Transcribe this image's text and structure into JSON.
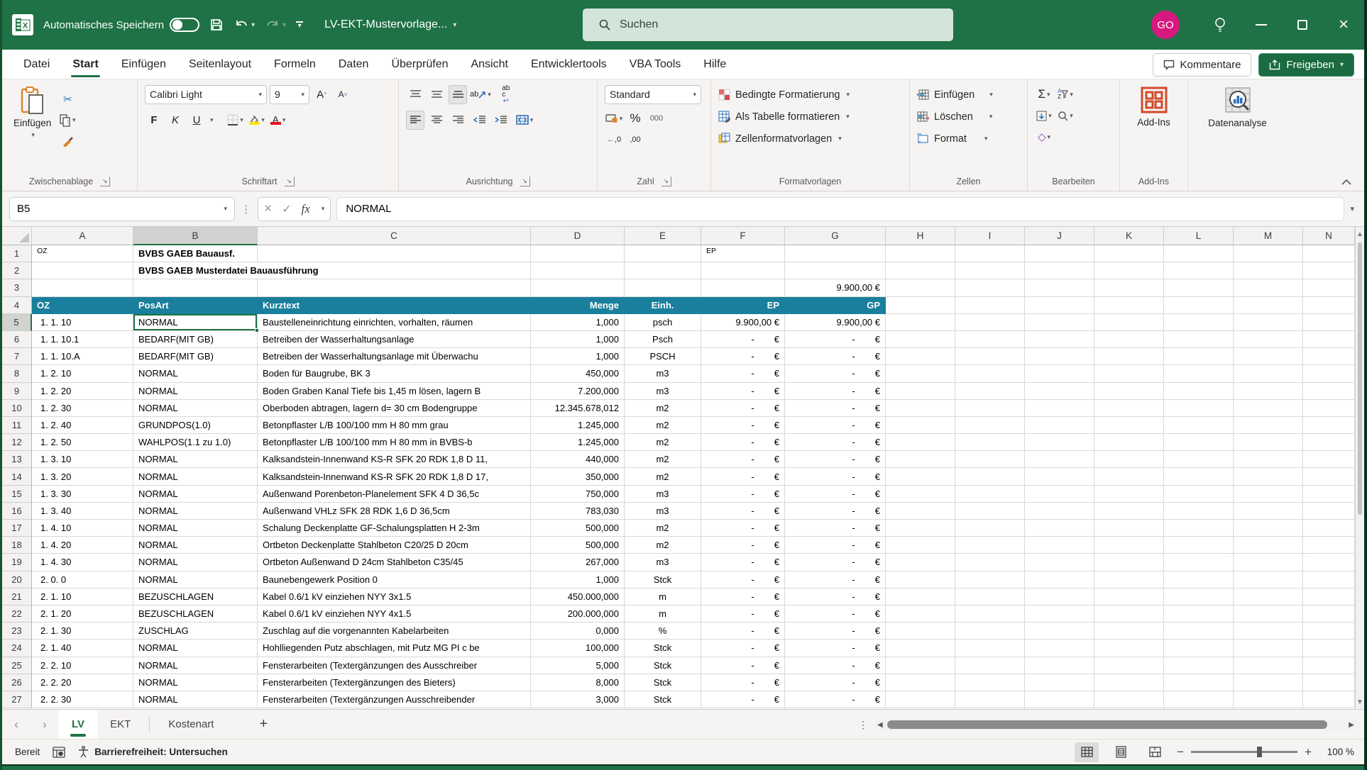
{
  "colors": {
    "titlebar_green": "#1f7245",
    "table_header_teal": "#1a7f9c",
    "selection_green": "#1f7245",
    "avatar_pink": "#d6187f",
    "share_button_green": "#1a6b3f"
  },
  "titlebar": {
    "autosave_label": "Automatisches Speichern",
    "autosave_state": "off",
    "document_title": "LV-EKT-Mustervorlage...",
    "search_placeholder": "Suchen",
    "avatar_initials": "GO"
  },
  "menubar": {
    "tabs": [
      "Datei",
      "Start",
      "Einfügen",
      "Seitenlayout",
      "Formeln",
      "Daten",
      "Überprüfen",
      "Ansicht",
      "Entwicklertools",
      "VBA Tools",
      "Hilfe"
    ],
    "active_tab": "Start",
    "comments_label": "Kommentare",
    "share_label": "Freigeben"
  },
  "ribbon": {
    "clipboard": {
      "label": "Zwischenablage",
      "paste_label": "Einfügen"
    },
    "font": {
      "label": "Schriftart",
      "name": "Calibri Light",
      "size": "9",
      "bold": "F",
      "italic": "K",
      "underline": "U"
    },
    "alignment": {
      "label": "Ausrichtung"
    },
    "number": {
      "label": "Zahl",
      "format": "Standard",
      "percent": "%",
      "thousands": "000",
      "dec_left": ",0",
      "dec_right": ",00"
    },
    "styles": {
      "label": "Formatvorlagen",
      "items": [
        "Bedingte Formatierung",
        "Als Tabelle formatieren",
        "Zellenformatvorlagen"
      ]
    },
    "cells": {
      "label": "Zellen",
      "items": [
        "Einfügen",
        "Löschen",
        "Format"
      ]
    },
    "editing": {
      "label": "Bearbeiten",
      "sigma": "Σ",
      "sort": "AZ"
    },
    "addins": {
      "button_label": "Add-Ins",
      "label": "Add-Ins"
    },
    "analysis": {
      "label": "Datenanalyse"
    }
  },
  "formula_bar": {
    "name_box": "B5",
    "formula": "NORMAL",
    "fx": "fx",
    "check": "✓",
    "cancel": "×"
  },
  "grid": {
    "columns": [
      "A",
      "B",
      "C",
      "D",
      "E",
      "F",
      "G",
      "H",
      "I",
      "J",
      "K",
      "L",
      "M",
      "N"
    ],
    "selected_cell": "B5",
    "selected_column": "B",
    "selected_row": 5,
    "currency_symbol": "€",
    "pre_rows": [
      {
        "num": 1,
        "cells": {
          "A": "OZ",
          "B": "BVBS GAEB Bauausf.",
          "F": "EP"
        }
      },
      {
        "num": 2,
        "cells": {
          "B": "BVBS GAEB Musterdatei Bauausführung"
        }
      },
      {
        "num": 3,
        "cells": {
          "G": "9.900,00 €"
        }
      }
    ],
    "header_row": {
      "num": 4,
      "oz": "OZ",
      "posart": "PosArt",
      "kurztext": "Kurztext",
      "menge": "Menge",
      "einh": "Einh.",
      "ep": "EP",
      "gp": "GP"
    },
    "data_rows": [
      {
        "num": 5,
        "oz": "1. 1. 10",
        "posart": "NORMAL",
        "kurztext": "Baustelleneinrichtung einrichten, vorhalten, räumen",
        "menge": "1,000",
        "einh": "psch",
        "ep": "9.900,00 €",
        "gp": "9.900,00 €"
      },
      {
        "num": 6,
        "oz": "1. 1. 10.1",
        "posart": "BEDARF(MIT GB)",
        "kurztext": "Betreiben der Wasserhaltungsanlage",
        "menge": "1,000",
        "einh": "Psch",
        "ep": "-",
        "gp": "-"
      },
      {
        "num": 7,
        "oz": "1. 1. 10.A",
        "posart": "BEDARF(MIT GB)",
        "kurztext": "Betreiben der Wasserhaltungsanlage mit Überwachu",
        "menge": "1,000",
        "einh": "PSCH",
        "ep": "-",
        "gp": "-"
      },
      {
        "num": 8,
        "oz": "1. 2. 10",
        "posart": "NORMAL",
        "kurztext": "Boden für Baugrube, BK 3",
        "menge": "450,000",
        "einh": "m3",
        "ep": "-",
        "gp": "-"
      },
      {
        "num": 9,
        "oz": "1. 2. 20",
        "posart": "NORMAL",
        "kurztext": "Boden Graben Kanal Tiefe bis 1,45 m lösen, lagern B",
        "menge": "7.200,000",
        "einh": "m3",
        "ep": "-",
        "gp": "-"
      },
      {
        "num": 10,
        "oz": "1. 2. 30",
        "posart": "NORMAL",
        "kurztext": "Oberboden abtragen, lagern d= 30 cm Bodengruppe",
        "menge": "12.345.678,012",
        "einh": "m2",
        "ep": "-",
        "gp": "-"
      },
      {
        "num": 11,
        "oz": "1. 2. 40",
        "posart": "GRUNDPOS(1.0)",
        "kurztext": "Betonpflaster L/B 100/100 mm H 80 mm  grau",
        "menge": "1.245,000",
        "einh": "m2",
        "ep": "-",
        "gp": "-"
      },
      {
        "num": 12,
        "oz": "1. 2. 50",
        "posart": "WAHLPOS(1.1 zu 1.0)",
        "kurztext": "Betonpflaster L/B 100/100 mm H 80 mm  in BVBS-b",
        "menge": "1.245,000",
        "einh": "m2",
        "ep": "-",
        "gp": "-"
      },
      {
        "num": 13,
        "oz": "1. 3. 10",
        "posart": "NORMAL",
        "kurztext": "Kalksandstein-Innenwand KS-R SFK 20 RDK 1,8 D 11,",
        "menge": "440,000",
        "einh": "m2",
        "ep": "-",
        "gp": "-"
      },
      {
        "num": 14,
        "oz": "1. 3. 20",
        "posart": "NORMAL",
        "kurztext": "Kalksandstein-Innenwand KS-R SFK 20 RDK 1,8 D 17,",
        "menge": "350,000",
        "einh": "m2",
        "ep": "-",
        "gp": "-"
      },
      {
        "num": 15,
        "oz": "1. 3. 30",
        "posart": "NORMAL",
        "kurztext": "Außenwand Porenbeton-Planelement SFK 4 D 36,5c",
        "menge": "750,000",
        "einh": "m3",
        "ep": "-",
        "gp": "-"
      },
      {
        "num": 16,
        "oz": "1. 3. 40",
        "posart": "NORMAL",
        "kurztext": "Außenwand VHLz SFK 28 RDK 1,6 D 36,5cm",
        "menge": "783,030",
        "einh": "m3",
        "ep": "-",
        "gp": "-"
      },
      {
        "num": 17,
        "oz": "1. 4. 10",
        "posart": "NORMAL",
        "kurztext": "Schalung Deckenplatte GF-Schalungsplatten H 2-3m",
        "menge": "500,000",
        "einh": "m2",
        "ep": "-",
        "gp": "-"
      },
      {
        "num": 18,
        "oz": "1. 4. 20",
        "posart": "NORMAL",
        "kurztext": "Ortbeton Deckenplatte Stahlbeton C20/25 D 20cm",
        "menge": "500,000",
        "einh": "m2",
        "ep": "-",
        "gp": "-"
      },
      {
        "num": 19,
        "oz": "1. 4. 30",
        "posart": "NORMAL",
        "kurztext": "Ortbeton Außenwand D 24cm Stahlbeton C35/45",
        "menge": "267,000",
        "einh": "m3",
        "ep": "-",
        "gp": "-"
      },
      {
        "num": 20,
        "oz": "2. 0.  0",
        "posart": "NORMAL",
        "kurztext": "Baunebengewerk Position 0",
        "menge": "1,000",
        "einh": "Stck",
        "ep": "-",
        "gp": "-"
      },
      {
        "num": 21,
        "oz": "2. 1. 10",
        "posart": "BEZUSCHLAGEN",
        "kurztext": "Kabel 0.6/1 kV einziehen NYY 3x1.5",
        "menge": "450.000,000",
        "einh": "m",
        "ep": "-",
        "gp": "-"
      },
      {
        "num": 22,
        "oz": "2. 1. 20",
        "posart": "BEZUSCHLAGEN",
        "kurztext": "Kabel 0.6/1 kV einziehen NYY 4x1.5",
        "menge": "200.000,000",
        "einh": "m",
        "ep": "-",
        "gp": "-"
      },
      {
        "num": 23,
        "oz": "2. 1. 30",
        "posart": "ZUSCHLAG",
        "kurztext": "Zuschlag auf die vorgenannten Kabelarbeiten",
        "menge": "0,000",
        "einh": "%",
        "ep": "-",
        "gp": "-"
      },
      {
        "num": 24,
        "oz": "2. 1. 40",
        "posart": "NORMAL",
        "kurztext": "Hohlliegenden Putz abschlagen, mit Putz MG PI c be",
        "menge": "100,000",
        "einh": "Stck",
        "ep": "-",
        "gp": "-"
      },
      {
        "num": 25,
        "oz": "2. 2. 10",
        "posart": "NORMAL",
        "kurztext": "Fensterarbeiten (Textergänzungen des Ausschreiber",
        "menge": "5,000",
        "einh": "Stck",
        "ep": "-",
        "gp": "-"
      },
      {
        "num": 26,
        "oz": "2. 2. 20",
        "posart": "NORMAL",
        "kurztext": "Fensterarbeiten (Textergänzungen des Bieters)",
        "menge": "8,000",
        "einh": "Stck",
        "ep": "-",
        "gp": "-"
      },
      {
        "num": 27,
        "oz": "2. 2. 30",
        "posart": "NORMAL",
        "kurztext": "Fensterarbeiten (Textergänzungen Ausschreibender",
        "menge": "3,000",
        "einh": "Stck",
        "ep": "-",
        "gp": "-"
      }
    ]
  },
  "sheet_tabs": {
    "tabs": [
      "LV",
      "EKT",
      "Kostenart"
    ],
    "active": "LV"
  },
  "status_bar": {
    "mode": "Bereit",
    "accessibility": "Barrierefreiheit: Untersuchen",
    "zoom": "100 %"
  }
}
